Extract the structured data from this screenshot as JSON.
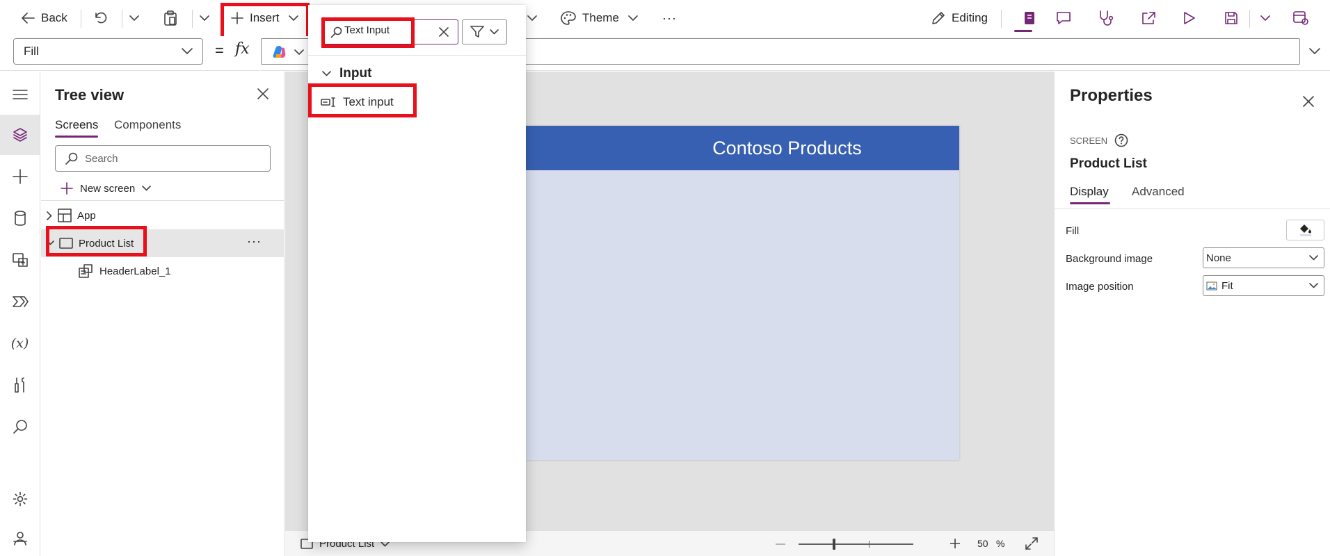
{
  "toolbar": {
    "back_label": "Back",
    "insert_label": "Insert",
    "theme_label": "Theme",
    "more_label": "···",
    "editing_label": "Editing"
  },
  "formula_bar": {
    "property": "Fill",
    "equals": "=",
    "fx": "fx",
    "formula": ""
  },
  "tree_view": {
    "title": "Tree view",
    "tabs": [
      "Screens",
      "Components"
    ],
    "search_placeholder": "Search",
    "new_screen_label": "New screen",
    "nodes": [
      {
        "label": "App"
      },
      {
        "label": "Product List"
      },
      {
        "label": "HeaderLabel_1"
      }
    ],
    "node_more": "···"
  },
  "insert_flyout": {
    "search_value": "Text Input",
    "group_label": "Input",
    "items": [
      {
        "label": "Text input"
      }
    ]
  },
  "canvas": {
    "header_text": "Contoso Products",
    "header_color": "#3760b2",
    "screen_bg": "#d8dded"
  },
  "status_bar": {
    "screen_name": "Product List",
    "zoom_value": "50",
    "zoom_unit": "%"
  },
  "properties": {
    "title": "Properties",
    "type_label": "SCREEN",
    "name": "Product List",
    "tabs": [
      "Display",
      "Advanced"
    ],
    "rows": [
      {
        "label": "Fill"
      },
      {
        "label": "Background image",
        "value": "None"
      },
      {
        "label": "Image position",
        "value": "Fit"
      }
    ]
  },
  "colors": {
    "accent": "#742774",
    "highlight": "#e8101a"
  }
}
